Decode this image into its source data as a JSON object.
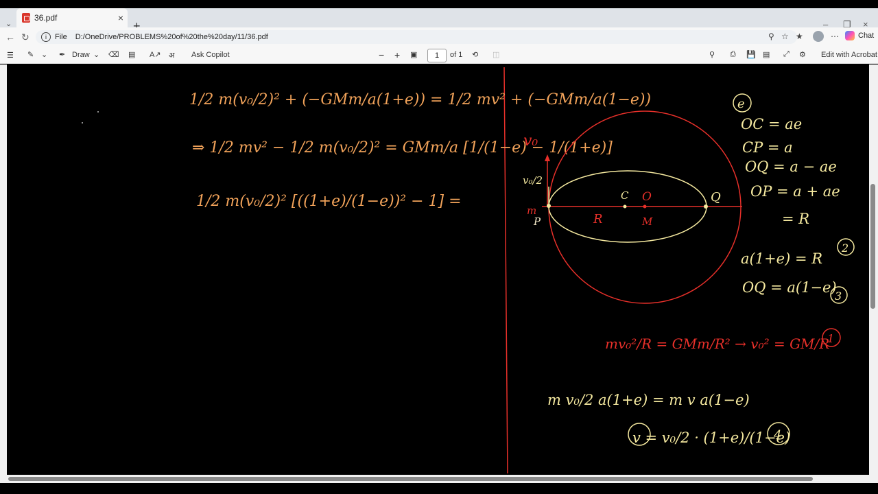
{
  "browser": {
    "tab_title": "36.pdf",
    "address_label": "File",
    "url": "D:/OneDrive/PROBLEMS%20of%20the%20day/11/36.pdf",
    "chat_label": "Chat"
  },
  "pdf_toolbar": {
    "draw_label": "Draw",
    "ask_copilot_label": "Ask Copilot",
    "page_number": "1",
    "page_total": "of 1",
    "edit_acrobat_label": "Edit with Acrobat"
  },
  "notes": {
    "left": {
      "line1": "1/2 m(v₀/2)² + (−GMm/a(1+e)) = 1/2 mv² + (−GMm/a(1−e))",
      "line2": "⇒ 1/2 mv² − 1/2 m(v₀/2)² = GMm/a [1/(1−e) − 1/(1+e)]",
      "line3": "1/2 m(v₀/2)² [((1+e)/(1−e))² − 1] ="
    },
    "diagram": {
      "v0": "v₀",
      "v0_half": "v₀/2",
      "m": "m",
      "P": "P",
      "C": "C",
      "O": "O",
      "Q": "Q",
      "R": "R",
      "M": "M"
    },
    "right": {
      "circled_e": "e",
      "oc": "OC = ae",
      "cp": "CP = a",
      "oq": "OQ = a − ae",
      "op": "OP = a + ae",
      "eqR": "= R",
      "eq2": "a(1+e) = R",
      "eq2_num": "2",
      "eq3": "OQ = a(1−e)",
      "eq3_num": "3",
      "eq1": "mv₀²/R = GMm/R² → v₀² = GM/R",
      "eq1_num": "1",
      "eq4a": "m v₀/2 a(1+e) = m v a(1−e)",
      "eq4b": "v = v₀/2 · (1+e)/(1−e)",
      "eq4_num": "4"
    }
  },
  "colors": {
    "ink_orange": "#f2a35a",
    "ink_red": "#e8302a",
    "ink_yellow": "#f6eaa0",
    "ink_cream": "#f4e9c8"
  }
}
